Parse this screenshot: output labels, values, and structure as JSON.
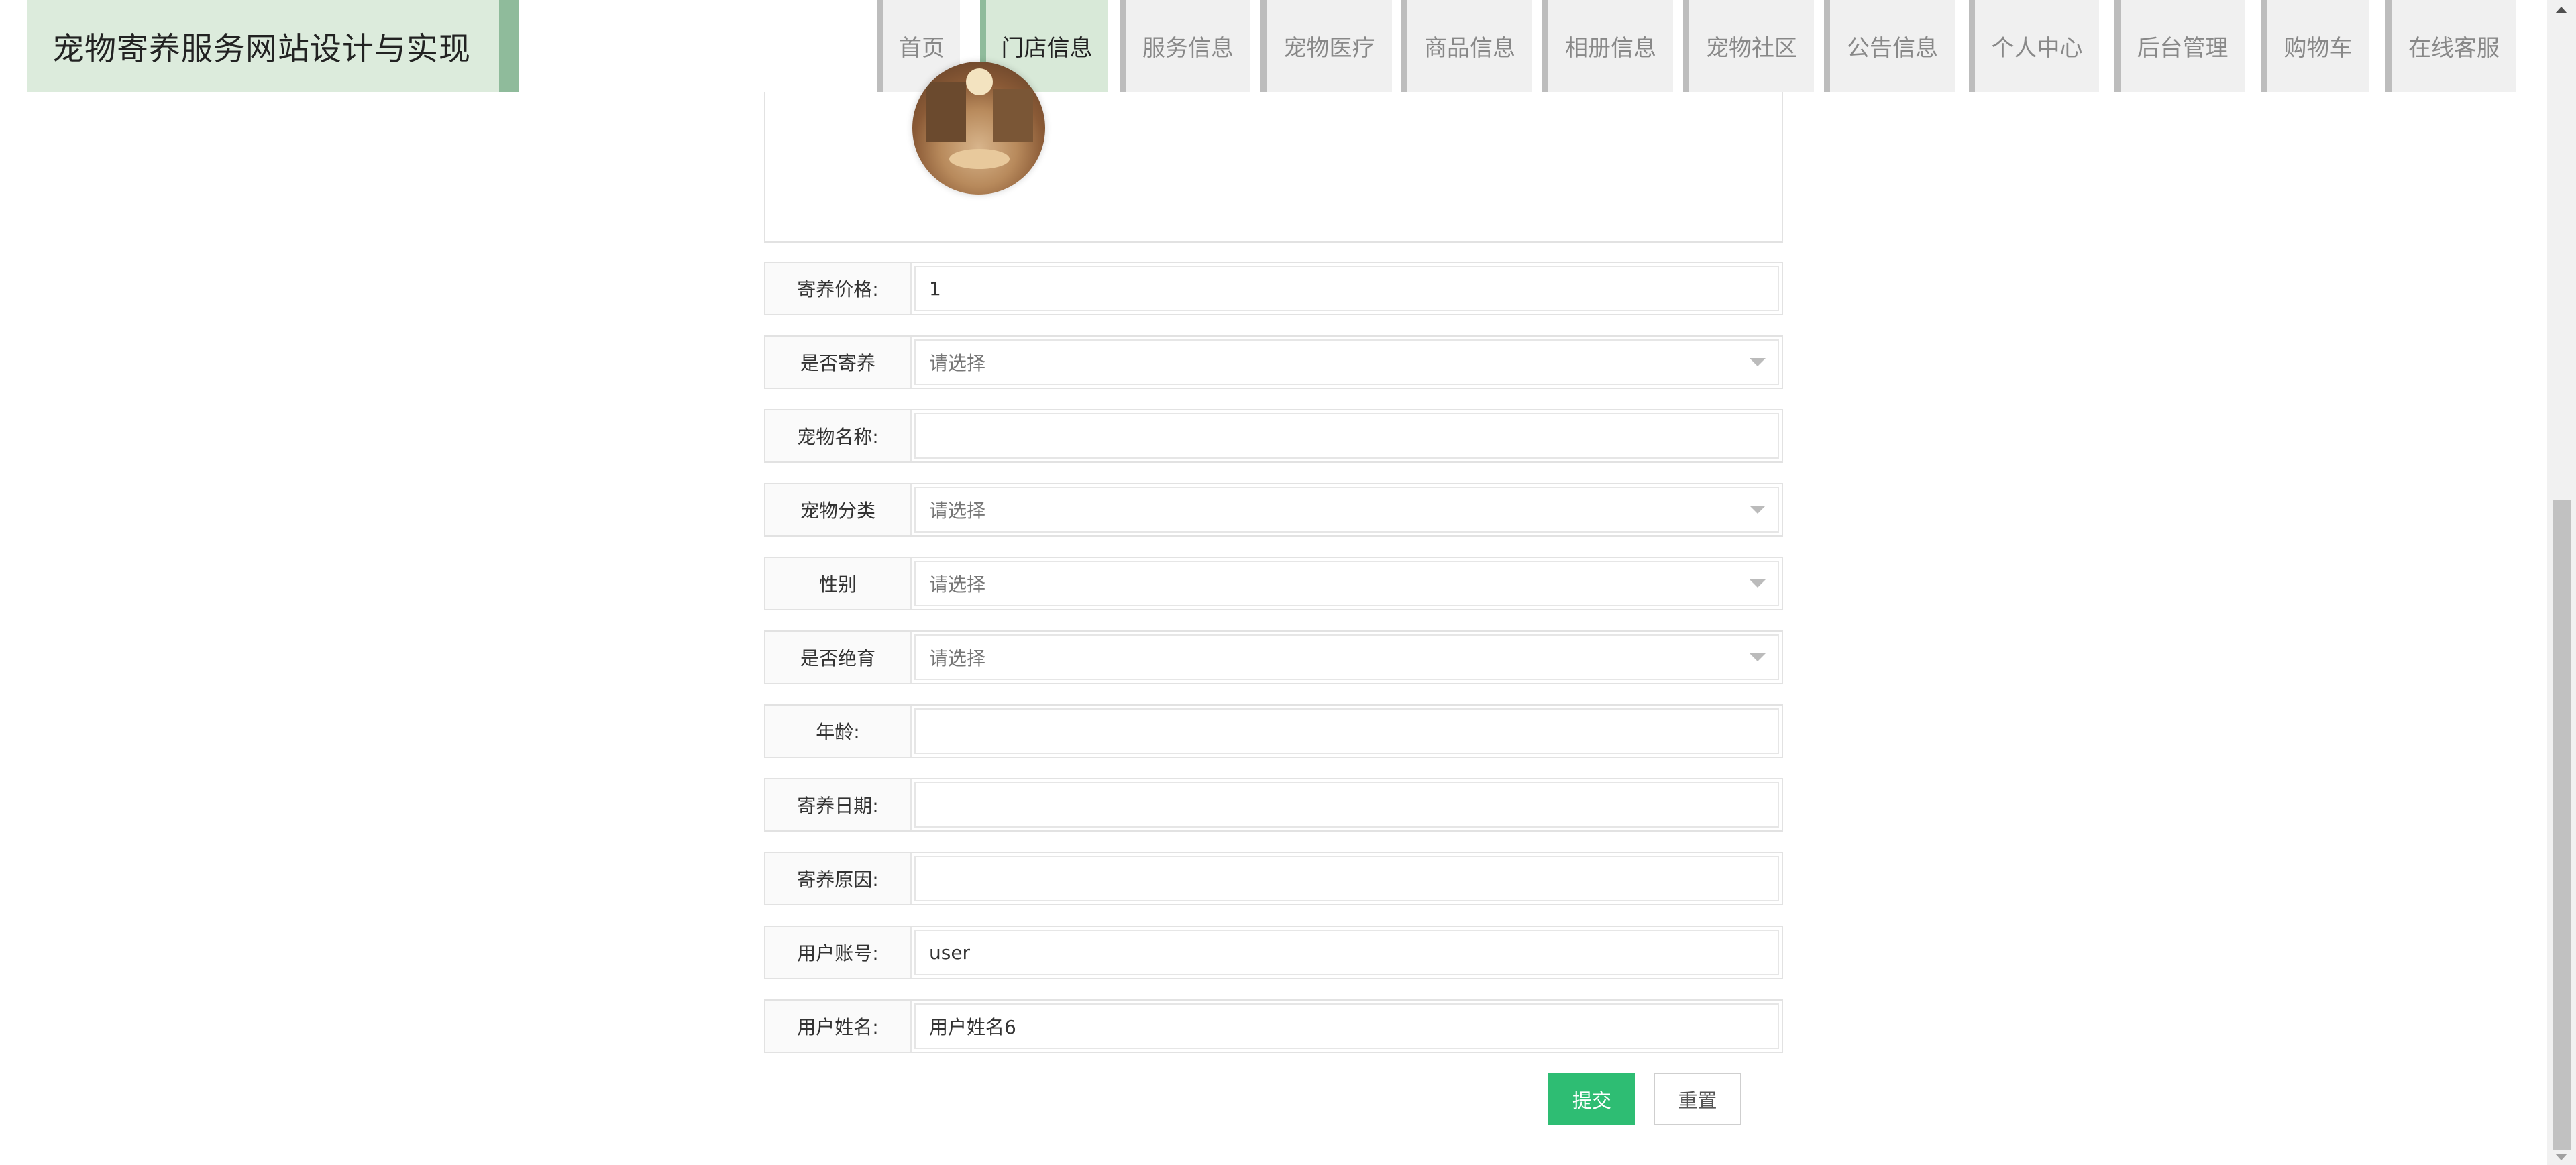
{
  "site": {
    "title": "宠物寄养服务网站设计与实现"
  },
  "nav": {
    "items": [
      {
        "label": "首页"
      },
      {
        "label": "门店信息",
        "active": true
      },
      {
        "label": "服务信息"
      },
      {
        "label": "宠物医疗"
      },
      {
        "label": "商品信息"
      },
      {
        "label": "相册信息"
      },
      {
        "label": "宠物社区"
      },
      {
        "label": "公告信息"
      },
      {
        "label": "个人中心"
      },
      {
        "label": "后台管理"
      },
      {
        "label": "购物车"
      },
      {
        "label": "在线客服"
      }
    ]
  },
  "form": {
    "price": {
      "label": "寄养价格:",
      "value": "1"
    },
    "is_boarding": {
      "label": "是否寄养",
      "placeholder": "请选择"
    },
    "pet_name": {
      "label": "宠物名称:",
      "value": ""
    },
    "pet_category": {
      "label": "宠物分类",
      "placeholder": "请选择"
    },
    "gender": {
      "label": "性别",
      "placeholder": "请选择"
    },
    "neutered": {
      "label": "是否绝育",
      "placeholder": "请选择"
    },
    "age": {
      "label": "年龄:",
      "value": ""
    },
    "boarding_date": {
      "label": "寄养日期:",
      "value": ""
    },
    "boarding_reason": {
      "label": "寄养原因:",
      "value": ""
    },
    "user_account": {
      "label": "用户账号:",
      "value": "user"
    },
    "user_name": {
      "label": "用户姓名:",
      "value": "用户姓名6"
    }
  },
  "buttons": {
    "submit": "提交",
    "reset": "重置"
  },
  "colors": {
    "accent": "#2ebd73",
    "header_bg": "#dcebdc",
    "active_nav": "#d8e9d8"
  },
  "icons": {
    "select_caret": "caret-down-icon"
  }
}
